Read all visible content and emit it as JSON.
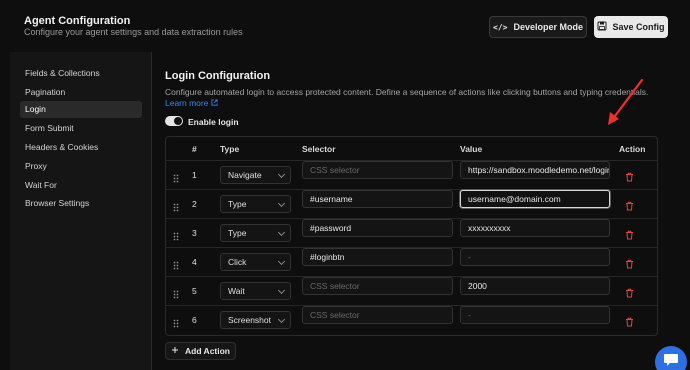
{
  "header": {
    "title": "Agent Configuration",
    "subtitle": "Configure your agent settings and data extraction rules",
    "dev_mode_label": "Developer Mode",
    "save_label": "Save Config",
    "dev_icon_glyph": "</>"
  },
  "sidebar": {
    "items": [
      {
        "label": "Fields & Collections",
        "active": false
      },
      {
        "label": "Pagination",
        "active": false
      },
      {
        "label": "Login",
        "active": true
      },
      {
        "label": "Form Submit",
        "active": false
      },
      {
        "label": "Headers & Cookies",
        "active": false
      },
      {
        "label": "Proxy",
        "active": false
      },
      {
        "label": "Wait For",
        "active": false
      },
      {
        "label": "Browser Settings",
        "active": false
      }
    ]
  },
  "login": {
    "title": "Login Configuration",
    "description": "Configure automated login to access protected content. Define a sequence of actions like clicking buttons and typing credentials.",
    "learn_more": "Learn more",
    "enable_label": "Enable login",
    "enabled": true,
    "columns": {
      "num": "#",
      "type": "Type",
      "selector": "Selector",
      "value": "Value",
      "action": "Action"
    },
    "rows": [
      {
        "num": "1",
        "type": "Navigate",
        "selector": "",
        "selector_placeholder": "CSS selector",
        "value": "https://sandbox.moodledemo.net/login",
        "value_placeholder": ""
      },
      {
        "num": "2",
        "type": "Type",
        "selector": "#username",
        "selector_placeholder": "",
        "value": "username@domain.com",
        "value_placeholder": ""
      },
      {
        "num": "3",
        "type": "Type",
        "selector": "#password",
        "selector_placeholder": "",
        "value": "xxxxxxxxxx",
        "value_placeholder": ""
      },
      {
        "num": "4",
        "type": "Click",
        "selector": "#loginbtn",
        "selector_placeholder": "",
        "value": "",
        "value_placeholder": "-"
      },
      {
        "num": "5",
        "type": "Wait",
        "selector": "",
        "selector_placeholder": "CSS selector",
        "value": "2000",
        "value_placeholder": ""
      },
      {
        "num": "6",
        "type": "Screenshot",
        "selector": "",
        "selector_placeholder": "CSS selector",
        "value": "",
        "value_placeholder": "-"
      }
    ],
    "add_action_label": "Add Action"
  },
  "colors": {
    "accent_blue": "#3b82f6",
    "trash_red": "#e0443c",
    "annotation_arrow": "#e8322b"
  }
}
